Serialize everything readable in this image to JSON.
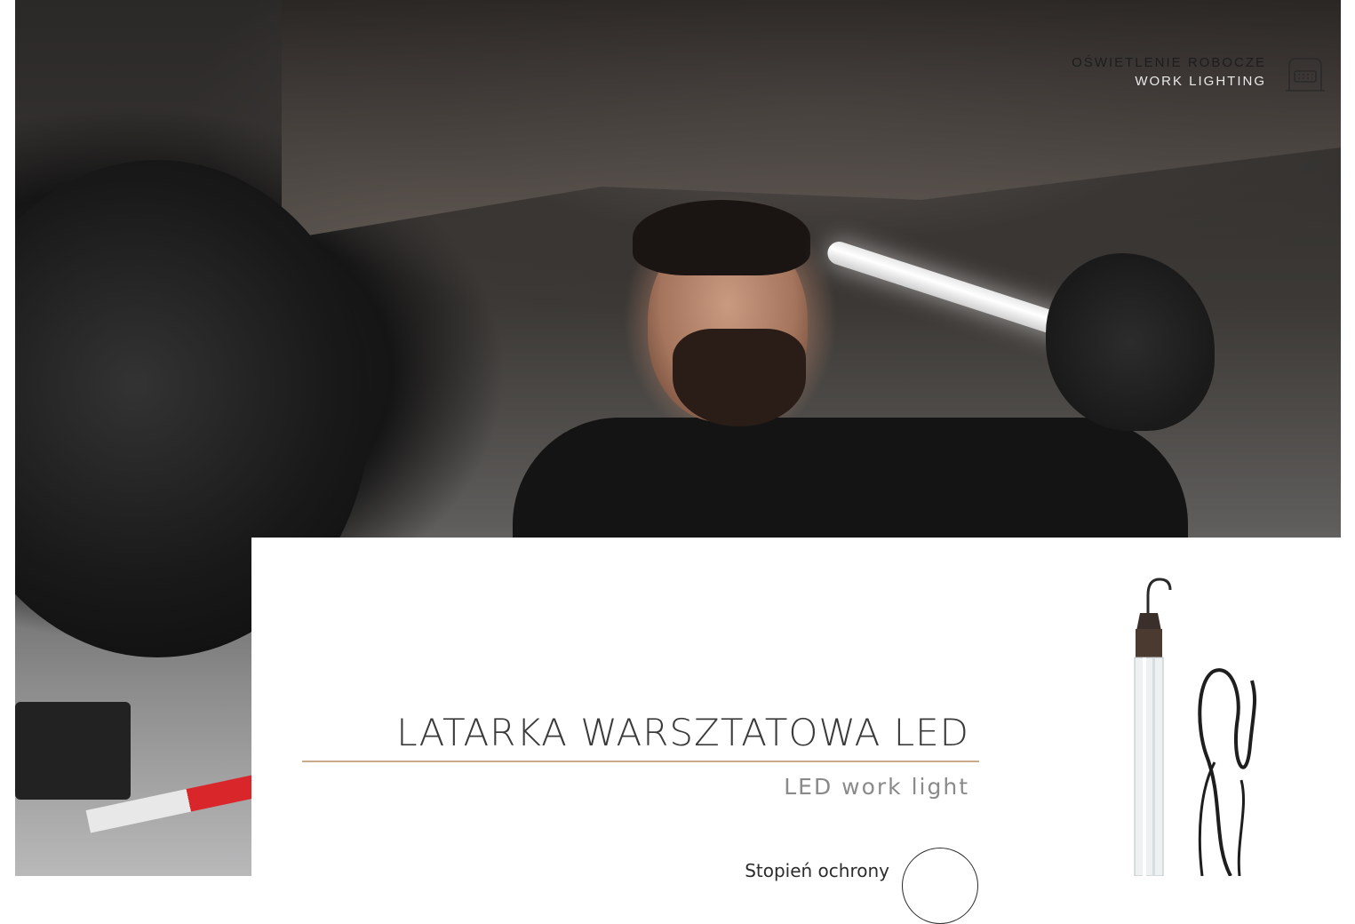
{
  "header": {
    "category_pl": "OŚWIETLENIE ROBOCZE",
    "category_en": "WORK LIGHTING",
    "category_icon": "work-light-icon"
  },
  "product": {
    "title": "LATARKA WARSZTATOWA LED",
    "subtitle": "LED work light",
    "spec_label": "Stopień ochrony"
  },
  "colors": {
    "accent_rule": "#c9ab8c",
    "title_text": "#3a3a3a",
    "subtitle_text": "#8a8a8a"
  }
}
